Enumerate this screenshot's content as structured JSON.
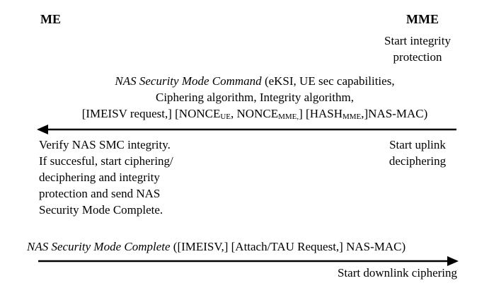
{
  "entities": {
    "left": "ME",
    "right": "MME"
  },
  "step1": {
    "mme_action_line1": "Start integrity",
    "mme_action_line2": "protection"
  },
  "msg1": {
    "name": "NAS Security Mode Command",
    "params_open": " (eKSI, UE sec capabilities,",
    "line2": "Ciphering algorithm, Integrity algorithm,",
    "l3_part1": "[IMEISV request,] [NONCE",
    "l3_sub1": "UE",
    "l3_part2": ", NONCE",
    "l3_sub2": "MME,",
    "l3_part3": "] [HASH",
    "l3_sub3": "MME",
    "l3_part4": ",]NAS-MAC)"
  },
  "me_actions": [
    "Verify NAS SMC integrity.",
    "If succesful, start ciphering/",
    "deciphering and integrity",
    "protection and send NAS",
    "Security Mode Complete."
  ],
  "mme_actions_after_msg1": [
    "Start uplink",
    "deciphering"
  ],
  "msg2": {
    "name": "NAS Security Mode Complete",
    "params": " ([IMEISV,] [Attach/TAU Request,] NAS-MAC)"
  },
  "step_final": {
    "mme_action": "Start downlink ciphering"
  }
}
